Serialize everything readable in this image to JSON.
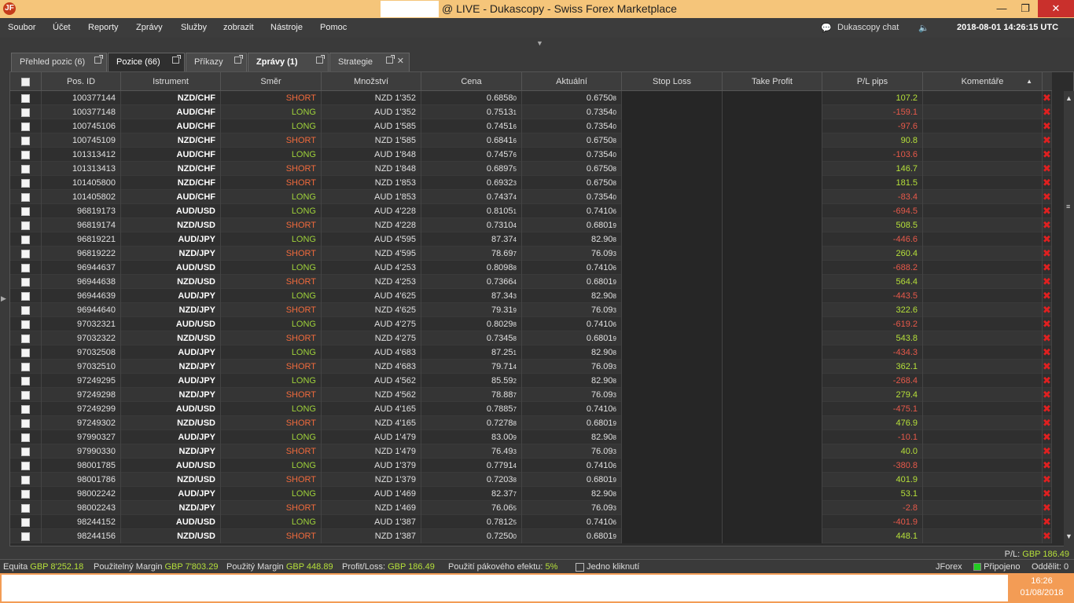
{
  "window": {
    "title": "@ LIVE - Dukascopy - Swiss Forex Marketplace",
    "logo": "JF"
  },
  "menu": {
    "items": [
      "Soubor",
      "Účet",
      "Reporty",
      "Zprávy",
      "Služby",
      "zobrazit",
      "Nástroje",
      "Pomoc"
    ],
    "chat": "Dukascopy chat",
    "clock": "2018-08-01 14:26:15 UTC"
  },
  "tabs": [
    {
      "label": "Přehled pozic (6)"
    },
    {
      "label": "Pozice (66)"
    },
    {
      "label": "Příkazy"
    },
    {
      "label": "Zprávy (1)"
    },
    {
      "label": "Strategie"
    }
  ],
  "table": {
    "columns": [
      "",
      "Pos. ID",
      "Istrument",
      "Směr",
      "Množství",
      "Cena",
      "Aktuální",
      "Stop Loss",
      "Take Profit",
      "P/L pips",
      "Komentáře"
    ],
    "rows": [
      [
        "100377144",
        "NZD/CHF",
        "SHORT",
        "NZD 1'352",
        "0.6858",
        "0",
        "0.6750",
        "8",
        "107.2"
      ],
      [
        "100377148",
        "AUD/CHF",
        "LONG",
        "AUD 1'352",
        "0.7513",
        "1",
        "0.7354",
        "0",
        "-159.1"
      ],
      [
        "100745106",
        "AUD/CHF",
        "LONG",
        "AUD 1'585",
        "0.7451",
        "6",
        "0.7354",
        "0",
        "-97.6"
      ],
      [
        "100745109",
        "NZD/CHF",
        "SHORT",
        "NZD 1'585",
        "0.6841",
        "6",
        "0.6750",
        "8",
        "90.8"
      ],
      [
        "101313412",
        "AUD/CHF",
        "LONG",
        "AUD 1'848",
        "0.7457",
        "6",
        "0.7354",
        "0",
        "-103.6"
      ],
      [
        "101313413",
        "NZD/CHF",
        "SHORT",
        "NZD 1'848",
        "0.6897",
        "5",
        "0.6750",
        "8",
        "146.7"
      ],
      [
        "101405800",
        "NZD/CHF",
        "SHORT",
        "NZD 1'853",
        "0.6932",
        "3",
        "0.6750",
        "8",
        "181.5"
      ],
      [
        "101405802",
        "AUD/CHF",
        "LONG",
        "AUD 1'853",
        "0.7437",
        "4",
        "0.7354",
        "0",
        "-83.4"
      ],
      [
        "96819173",
        "AUD/USD",
        "LONG",
        "AUD 4'228",
        "0.8105",
        "1",
        "0.7410",
        "6",
        "-694.5"
      ],
      [
        "96819174",
        "NZD/USD",
        "SHORT",
        "NZD 4'228",
        "0.7310",
        "4",
        "0.6801",
        "9",
        "508.5"
      ],
      [
        "96819221",
        "AUD/JPY",
        "LONG",
        "AUD 4'595",
        "87.37",
        "4",
        "82.90",
        "8",
        "-446.6"
      ],
      [
        "96819222",
        "NZD/JPY",
        "SHORT",
        "NZD 4'595",
        "78.69",
        "7",
        "76.09",
        "3",
        "260.4"
      ],
      [
        "96944637",
        "AUD/USD",
        "LONG",
        "AUD 4'253",
        "0.8098",
        "8",
        "0.7410",
        "6",
        "-688.2"
      ],
      [
        "96944638",
        "NZD/USD",
        "SHORT",
        "NZD 4'253",
        "0.7366",
        "4",
        "0.6801",
        "9",
        "564.4"
      ],
      [
        "96944639",
        "AUD/JPY",
        "LONG",
        "AUD 4'625",
        "87.34",
        "3",
        "82.90",
        "8",
        "-443.5"
      ],
      [
        "96944640",
        "NZD/JPY",
        "SHORT",
        "NZD 4'625",
        "79.31",
        "9",
        "76.09",
        "3",
        "322.6"
      ],
      [
        "97032321",
        "AUD/USD",
        "LONG",
        "AUD 4'275",
        "0.8029",
        "8",
        "0.7410",
        "6",
        "-619.2"
      ],
      [
        "97032322",
        "NZD/USD",
        "SHORT",
        "NZD 4'275",
        "0.7345",
        "8",
        "0.6801",
        "9",
        "543.8"
      ],
      [
        "97032508",
        "AUD/JPY",
        "LONG",
        "AUD 4'683",
        "87.25",
        "1",
        "82.90",
        "8",
        "-434.3"
      ],
      [
        "97032510",
        "NZD/JPY",
        "SHORT",
        "NZD 4'683",
        "79.71",
        "4",
        "76.09",
        "3",
        "362.1"
      ],
      [
        "97249295",
        "AUD/JPY",
        "LONG",
        "AUD 4'562",
        "85.59",
        "2",
        "82.90",
        "8",
        "-268.4"
      ],
      [
        "97249298",
        "NZD/JPY",
        "SHORT",
        "NZD 4'562",
        "78.88",
        "7",
        "76.09",
        "3",
        "279.4"
      ],
      [
        "97249299",
        "AUD/USD",
        "LONG",
        "AUD 4'165",
        "0.7885",
        "7",
        "0.7410",
        "6",
        "-475.1"
      ],
      [
        "97249302",
        "NZD/USD",
        "SHORT",
        "NZD 4'165",
        "0.7278",
        "8",
        "0.6801",
        "9",
        "476.9"
      ],
      [
        "97990327",
        "AUD/JPY",
        "LONG",
        "AUD 1'479",
        "83.00",
        "9",
        "82.90",
        "8",
        "-10.1"
      ],
      [
        "97990330",
        "NZD/JPY",
        "SHORT",
        "NZD 1'479",
        "76.49",
        "3",
        "76.09",
        "3",
        "40.0"
      ],
      [
        "98001785",
        "AUD/USD",
        "LONG",
        "AUD 1'379",
        "0.7791",
        "4",
        "0.7410",
        "6",
        "-380.8"
      ],
      [
        "98001786",
        "NZD/USD",
        "SHORT",
        "NZD 1'379",
        "0.7203",
        "8",
        "0.6801",
        "9",
        "401.9"
      ],
      [
        "98002242",
        "AUD/JPY",
        "LONG",
        "AUD 1'469",
        "82.37",
        "7",
        "82.90",
        "8",
        "53.1"
      ],
      [
        "98002243",
        "NZD/JPY",
        "SHORT",
        "NZD 1'469",
        "76.06",
        "5",
        "76.09",
        "3",
        "-2.8"
      ],
      [
        "98244152",
        "AUD/USD",
        "LONG",
        "AUD 1'387",
        "0.7812",
        "5",
        "0.7410",
        "6",
        "-401.9"
      ],
      [
        "98244156",
        "NZD/USD",
        "SHORT",
        "NZD 1'387",
        "0.7250",
        "0",
        "0.6801",
        "9",
        "448.1"
      ]
    ]
  },
  "pl_total": {
    "label": "P/L:",
    "value": "GBP 186.49"
  },
  "status": {
    "equity_label": "Equita",
    "equity_value": "GBP 8'252.18",
    "usable_label": "Použitelný Margin",
    "usable_value": "GBP 7'803.29",
    "used_label": "Použitý Margin",
    "used_value": "GBP 448.89",
    "pnl_label": "Profit/Loss:",
    "pnl_value": "GBP 186.49",
    "leverage_label": "Použití pákového efektu:",
    "leverage_value": "5%",
    "oneclick_label": "Jedno kliknutí",
    "platform": "JForex",
    "connected": "Připojeno",
    "detach": "Oddělit: 0"
  },
  "taskbar": {
    "time": "16:26",
    "date": "01/08/2018"
  },
  "colors": {
    "profit": "#b6e03a",
    "loss": "#e7594a",
    "short": "#f06a3c",
    "long": "#9ed13a",
    "close": "#e02020"
  }
}
